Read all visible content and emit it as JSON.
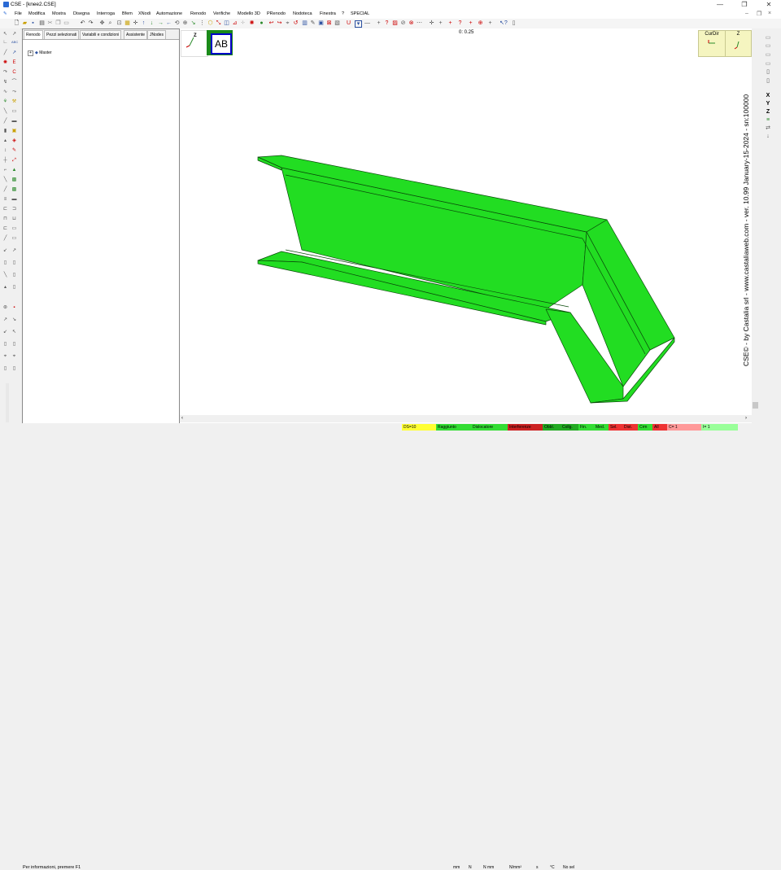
{
  "window": {
    "title": "CSE - [knee2.CSE]",
    "minimize": "—",
    "maximize": "❐",
    "close": "✕"
  },
  "menu": [
    "File",
    "Modifica",
    "Mostra",
    "Disegna",
    "Interroga",
    "Bfem",
    "XNodi",
    "Automazione",
    "Renodo",
    "Verifiche",
    "Modello 3D",
    "PRenodo",
    "Nodoteca",
    "Finestra",
    "?",
    "SPECIAL"
  ],
  "panel": {
    "tabs": [
      "Renodo",
      "Pezzi selezionati",
      "Variabili e condizioni",
      "Assistente",
      "JNodes"
    ],
    "tree_root": "Master"
  },
  "view": {
    "coordinate": "0: 0.25",
    "ab_label": "AB",
    "axis_z": "Z",
    "curdir_label": "CurDir",
    "curdir2_label": "Z",
    "version_text": "CSE© - by Castalia srl - www.castaliaweb.com - ver. 10.99 January-15-2024 - sn:100000",
    "model_color": "#22dd22"
  },
  "right_tools": [
    "X",
    "Y",
    "Z"
  ],
  "status": {
    "cells": [
      {
        "label": "DS=10",
        "bg": "#ffff33"
      },
      {
        "label": "Raggiunto",
        "bg": "#33dd33"
      },
      {
        "label": "Dislocatore",
        "bg": "#33dd33"
      },
      {
        "label": "Interferenze",
        "bg": "#cc2222"
      },
      {
        "label": "Obbl.",
        "bg": "#22aa22"
      },
      {
        "label": "Collg.",
        "bg": "#22aa22"
      },
      {
        "label": "Fin.",
        "bg": "#33dd33"
      },
      {
        "label": "Med.",
        "bg": "#33dd33"
      },
      {
        "label": "Sel.",
        "bg": "#ee3333"
      },
      {
        "label": "Dist.",
        "bg": "#ee3333"
      },
      {
        "label": "Crm",
        "bg": "#33dd33"
      },
      {
        "label": "All",
        "bg": "#ee3333"
      },
      {
        "label": "C= 1",
        "bg": "#ff9999"
      },
      {
        "label": "I= 1",
        "bg": "#99ff99"
      }
    ],
    "info": "Per informazioni, premere F1",
    "units": [
      "mm",
      "N",
      "N mm",
      "N/mm²",
      "s",
      "°C",
      "No sel"
    ]
  }
}
